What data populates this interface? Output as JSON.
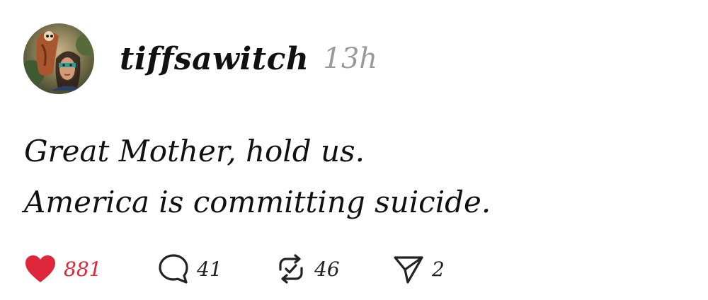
{
  "post": {
    "username": "tiffsawitch",
    "timestamp": "13h",
    "lines": [
      "Great Mother, hold us.",
      "America is committing suicide."
    ]
  },
  "actions": {
    "likes": "881",
    "replies": "41",
    "reposts": "46",
    "shares": "2"
  },
  "icons": {
    "like": "heart-icon",
    "reply": "speech-bubble-icon",
    "repost": "repost-icon",
    "share": "paper-plane-icon"
  },
  "colors": {
    "like_active": "#e0263a",
    "timestamp": "#9a9a9a",
    "text": "#111111"
  }
}
